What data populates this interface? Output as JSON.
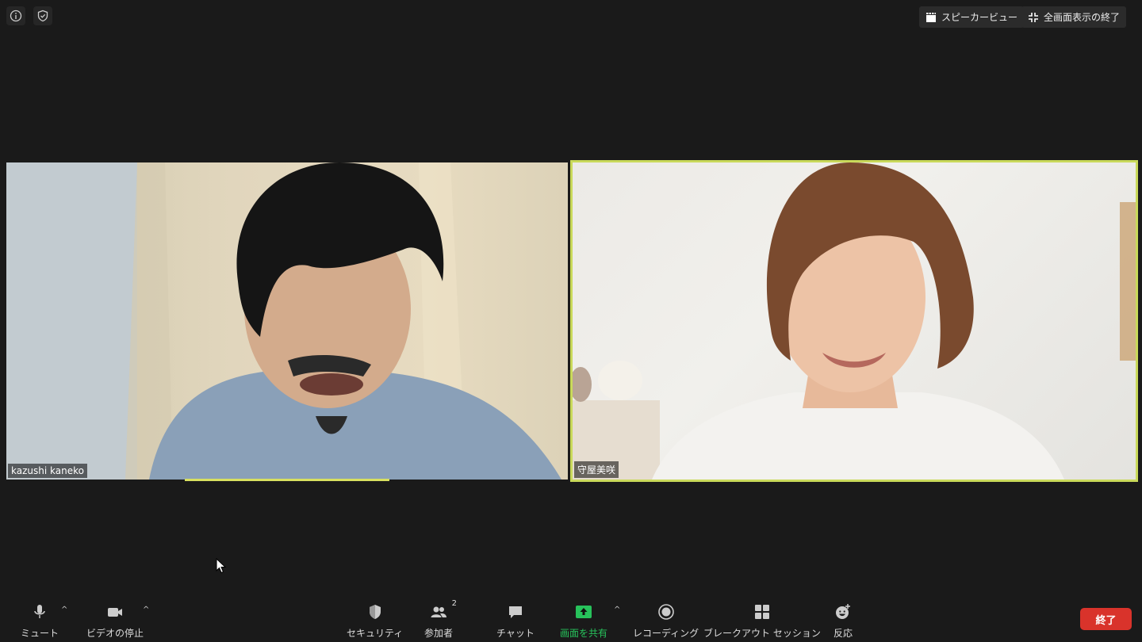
{
  "header": {
    "speaker_view_label": "スピーカービュー",
    "exit_fullscreen_label": "全画面表示の終了"
  },
  "participants": [
    {
      "name": "kazushi kaneko",
      "speaking": true
    },
    {
      "name": "守屋美咲",
      "active": true
    }
  ],
  "toolbar": {
    "mute_label": "ミュート",
    "video_label": "ビデオの停止",
    "security_label": "セキュリティ",
    "participants_label": "参加者",
    "participants_count": "2",
    "chat_label": "チャット",
    "share_label": "画面を共有",
    "record_label": "レコーディング",
    "breakout_label": "ブレークアウト セッション",
    "reactions_label": "反応",
    "end_label": "終了"
  },
  "colors": {
    "background": "#1a1a1a",
    "active_speaker_border": "#c9d95a",
    "share_green": "#27c25b",
    "end_red": "#d9332b"
  }
}
